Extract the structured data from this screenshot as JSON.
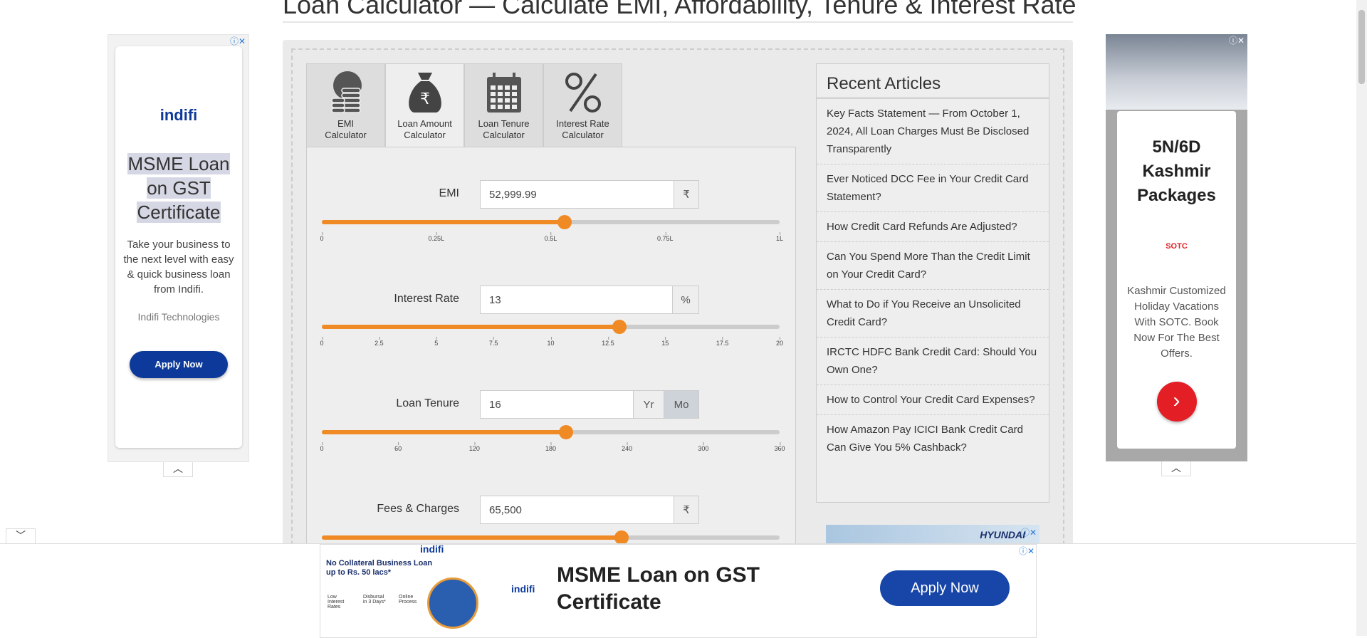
{
  "page": {
    "title": "Loan Calculator — Calculate EMI, Affordability, Tenure & Interest Rate"
  },
  "tabs": [
    {
      "label_line1": "EMI",
      "label_line2": "Calculator",
      "icon": "coins-icon"
    },
    {
      "label_line1": "Loan Amount",
      "label_line2": "Calculator",
      "icon": "money-bag-icon"
    },
    {
      "label_line1": "Loan Tenure",
      "label_line2": "Calculator",
      "icon": "calendar-icon"
    },
    {
      "label_line1": "Interest Rate",
      "label_line2": "Calculator",
      "icon": "percent-icon"
    }
  ],
  "active_tab": 1,
  "form": {
    "emi": {
      "label": "EMI",
      "value": "52,999.99",
      "addon": "₹",
      "slider_value": 0.53,
      "ticks": [
        "0",
        "0.25L",
        "0.5L",
        "0.75L",
        "1L"
      ]
    },
    "interest": {
      "label": "Interest Rate",
      "value": "13",
      "addon": "%",
      "slider_value": 13,
      "slider_max": 20,
      "ticks": [
        "0",
        "2.5",
        "5",
        "7.5",
        "10",
        "12.5",
        "15",
        "17.5",
        "20"
      ]
    },
    "tenure": {
      "label": "Loan Tenure",
      "value": "16",
      "addon_yr": "Yr",
      "addon_mo": "Mo",
      "selected_unit": "Mo",
      "slider_value": 192,
      "slider_max": 360,
      "ticks": [
        "0",
        "60",
        "120",
        "180",
        "240",
        "300",
        "360"
      ]
    },
    "fees": {
      "label": "Fees & Charges",
      "value": "65,500",
      "addon": "₹",
      "slider_fraction": 0.655
    }
  },
  "articles": {
    "heading": "Recent Articles",
    "items": [
      "Key Facts Statement — From October 1, 2024, All Loan Charges Must Be Disclosed Transparently",
      "Ever Noticed DCC Fee in Your Credit Card Statement?",
      "How Credit Card Refunds Are Adjusted?",
      "Can You Spend More Than the Credit Limit on Your Credit Card?",
      "What to Do if You Receive an Unsolicited Credit Card?",
      "IRCTC HDFC Bank Credit Card: Should You Own One?",
      "How to Control Your Credit Card Expenses?",
      "How Amazon Pay ICICI Bank Credit Card Can Give You 5% Cashback?"
    ]
  },
  "ad_left": {
    "brand": "indifi",
    "headline": "MSME Loan on GST Certificate",
    "body": "Take your business to the next level with easy & quick business loan from Indifi.",
    "advertiser": "Indifi Technologies",
    "cta": "Apply Now"
  },
  "ad_right": {
    "headline": "5N/6D Kashmir Packages",
    "brand": "SOTC",
    "body": "Kashmir Customized Holiday Vacations With SOTC. Book Now For The Best Offers."
  },
  "ad_mid": {
    "brand": "HYUNDAI"
  },
  "ad_bottom": {
    "brand": "indifi",
    "banner_text": "No Collateral Business Loan up to Rs. 50 lacs*",
    "feature1": "Low Interest Rates",
    "feature2": "Disbursal in 3 Days*",
    "feature3": "Online Process",
    "headline": "MSME Loan on GST Certificate",
    "cta": "Apply Now"
  },
  "colors": {
    "accent": "#f08a24",
    "ad_blue": "#0d3a9a",
    "sotc_red": "#e31e24"
  }
}
